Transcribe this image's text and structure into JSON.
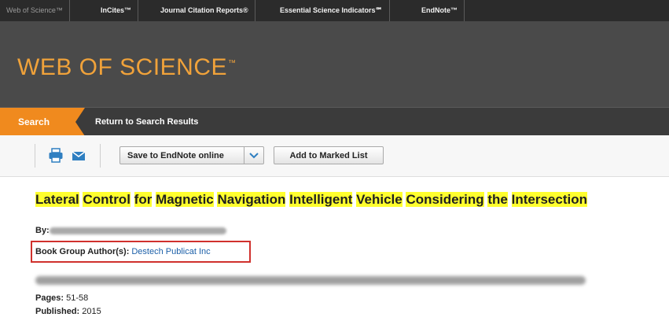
{
  "top_nav": {
    "items": [
      "Web of Science™",
      "InCites™",
      "Journal Citation Reports®",
      "Essential Science Indicators℠",
      "EndNote™"
    ]
  },
  "header": {
    "logo_text": "WEB OF SCIENCE",
    "logo_mark": "™"
  },
  "sub_nav": {
    "search_tab": "Search",
    "return_link": "Return to Search Results"
  },
  "toolbar": {
    "icons": [
      "print-icon",
      "email-icon"
    ],
    "save_dropdown_label": "Save to EndNote online",
    "add_marked_label": "Add to Marked List"
  },
  "record": {
    "title_words": [
      "Lateral",
      "Control",
      "for",
      "Magnetic",
      "Navigation",
      "Intelligent",
      "Vehicle",
      "Considering",
      "the",
      "Intersection"
    ],
    "by_label": "By:",
    "book_group_author_label": "Book Group Author(s):",
    "book_group_author_value": "Destech Publicat Inc",
    "pages_label": "Pages:",
    "pages_value": "51-58",
    "published_label": "Published:",
    "published_value": "2015"
  },
  "colors": {
    "logo": "#f0a23a",
    "search_tab": "#f08a1e",
    "highlight": "#ffff2e",
    "annotation_box": "#d0312d",
    "link": "#1b5fa8"
  }
}
